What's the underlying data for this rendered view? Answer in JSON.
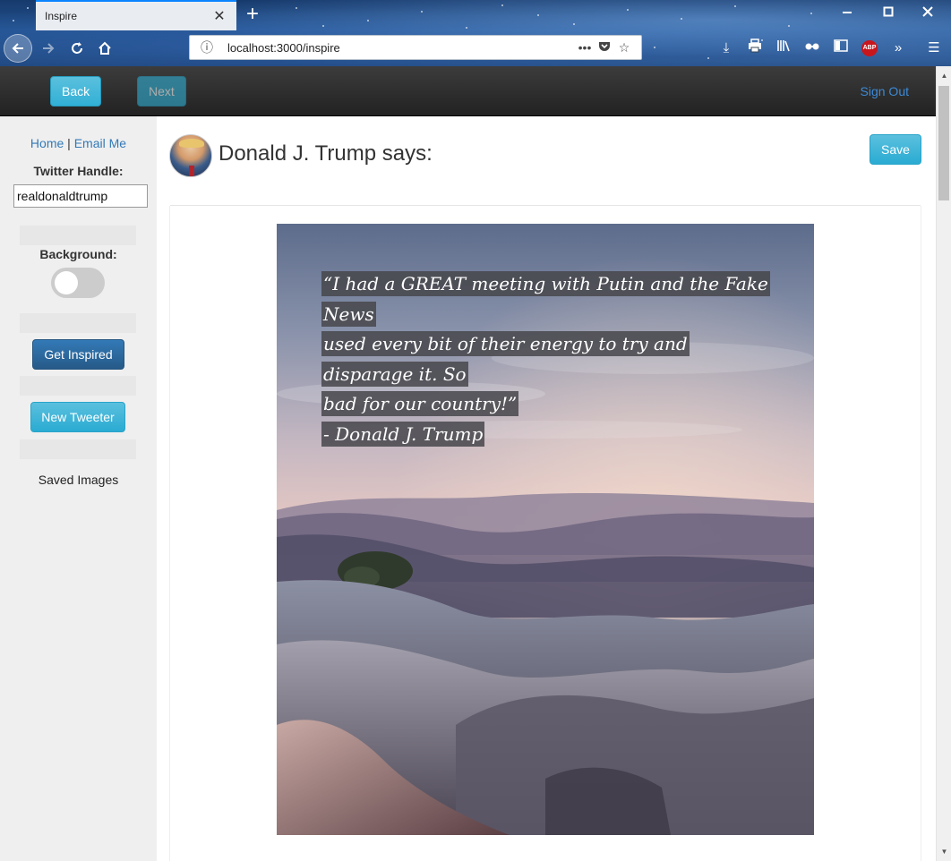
{
  "browser": {
    "tab_title": "Inspire",
    "url": "localhost:3000/inspire",
    "page_actions_icon": "•••"
  },
  "navbar": {
    "back_label": "Back",
    "next_label": "Next",
    "signout_label": "Sign Out"
  },
  "sidebar": {
    "home_link": "Home",
    "separator": "|",
    "email_link": "Email Me",
    "twitter_handle_label": "Twitter Handle:",
    "twitter_handle_value": "realdonaldtrump",
    "background_label": "Background:",
    "background_toggle_on": false,
    "get_inspired_label": "Get Inspired",
    "new_tweeter_label": "New Tweeter",
    "saved_images_label": "Saved Images"
  },
  "main": {
    "heading": "Donald J. Trump says:",
    "save_label": "Save",
    "quote_lines": [
      "“I had a GREAT meeting with Putin and the Fake News",
      "used every bit of their energy to try and disparage it. So",
      "bad for our country!”",
      "- Donald J. Trump"
    ]
  },
  "colors": {
    "accent_info": "#5bc0de",
    "primary": "#337ab7",
    "link": "#337ab7",
    "navbar": "#222222"
  }
}
